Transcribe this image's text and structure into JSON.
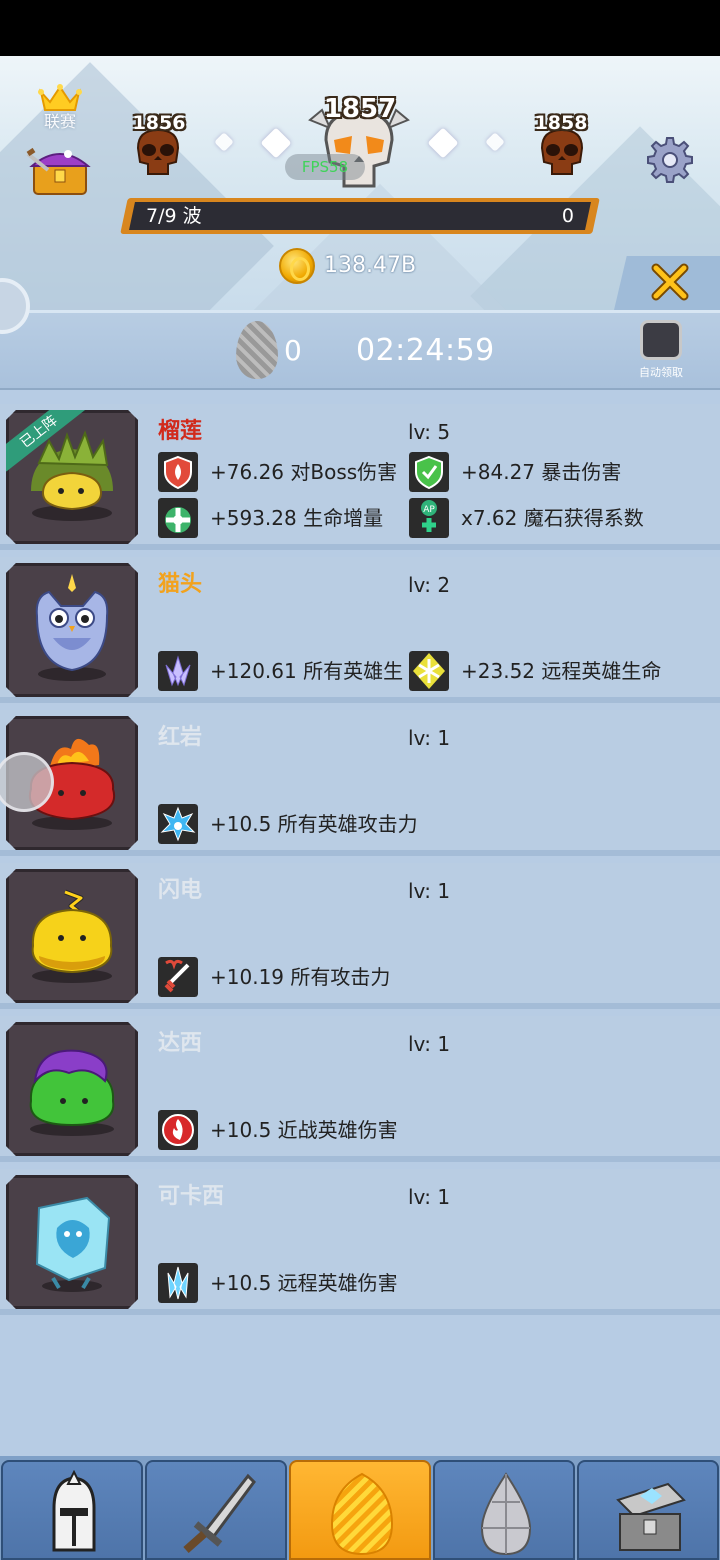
{
  "header": {
    "league_label": "联赛",
    "stages": {
      "prev": "1856",
      "current": "1857",
      "next": "1858"
    },
    "fps": "FPS58",
    "wave": {
      "label": "7/9 波",
      "value": "0"
    },
    "coins": "138.47B"
  },
  "timer_row": {
    "egg_count": "0",
    "countdown": "02:24:59",
    "auto_collect_label": "自动领取"
  },
  "heroes": [
    {
      "name": "榴莲",
      "name_color": "#d12a1c",
      "level": "lv: 5",
      "badge": "已上阵",
      "stats": [
        {
          "icon": "fire-shield-icon",
          "text": "+76.26 对Boss伤害"
        },
        {
          "icon": "green-shield-icon",
          "text": "+84.27 暴击伤害"
        },
        {
          "icon": "heart-plus-icon",
          "text": "+593.28 生命增量"
        },
        {
          "icon": "ap-stone-icon",
          "text": "x7.62 魔石获得系数"
        }
      ]
    },
    {
      "name": "猫头",
      "name_color": "#f2a21d",
      "level": "lv: 2",
      "stats": [
        {
          "icon": "lotus-icon",
          "text": "+120.61 所有英雄生"
        },
        {
          "icon": "snowflake-icon",
          "text": "+23.52 远程英雄生命"
        }
      ]
    },
    {
      "name": "红岩",
      "name_color": "#dfe6ee",
      "level": "lv: 1",
      "stats": [
        {
          "icon": "burst-icon",
          "text": "+10.5 所有英雄攻击力"
        }
      ]
    },
    {
      "name": "闪电",
      "name_color": "#dfe6ee",
      "level": "lv: 1",
      "stats": [
        {
          "icon": "sword-icon",
          "text": "+10.19 所有攻击力"
        }
      ]
    },
    {
      "name": "达西",
      "name_color": "#dfe6ee",
      "level": "lv: 1",
      "stats": [
        {
          "icon": "flame-icon",
          "text": "+10.5 近战英雄伤害"
        }
      ]
    },
    {
      "name": "可卡西",
      "name_color": "#dfe6ee",
      "level": "lv: 1",
      "stats": [
        {
          "icon": "crystal-icon",
          "text": "+10.5 远程英雄伤害"
        }
      ]
    }
  ],
  "nav": [
    "helmet-icon",
    "sword-icon",
    "egg-icon",
    "gem-icon",
    "treasure-chest-icon"
  ],
  "colors": {
    "accent_orange": "#f39a11",
    "card_bg": "#b9cde3",
    "nav_blue": "#5e86bd"
  }
}
